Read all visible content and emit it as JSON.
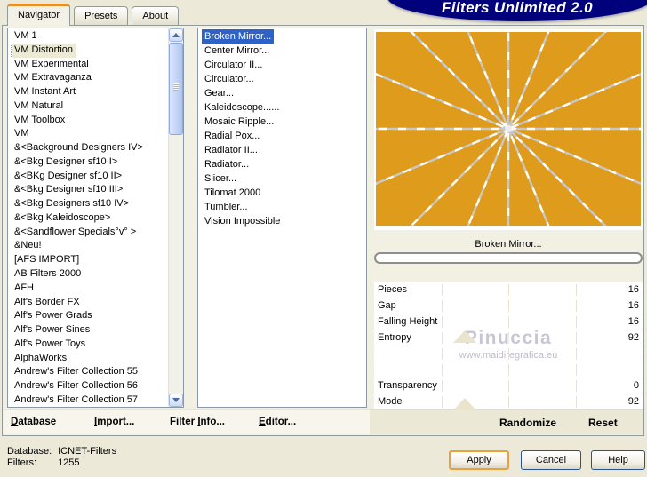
{
  "window": {
    "logo": "Filters Unlimited 2.0"
  },
  "tabs": [
    "Navigator",
    "Presets",
    "About"
  ],
  "colors": {
    "selection": "#2E63C5",
    "logo_bg": "#01017C",
    "preview_bg": "#DF9B1B",
    "accent_tab": "#E5912D"
  },
  "navigator": {
    "selected": "VM Distortion",
    "items": [
      "VM 1",
      "VM Distortion",
      "VM Experimental",
      "VM Extravaganza",
      "VM Instant Art",
      "VM Natural",
      "VM Toolbox",
      "VM",
      "&<Background Designers IV>",
      "&<Bkg Designer sf10 I>",
      "&<BKg Designer sf10 II>",
      "&<Bkg Designer sf10 III>",
      "&<Bkg Designers sf10 IV>",
      "&<Bkg Kaleidoscope>",
      "&<Sandflower Specials°v° >",
      "&Neu!",
      "[AFS IMPORT]",
      "AB Filters 2000",
      "AFH",
      "Alf's Border FX",
      "Alf's Power Grads",
      "Alf's Power Sines",
      "Alf's Power Toys",
      "AlphaWorks",
      "Andrew's Filter Collection 55",
      "Andrew's Filter Collection 56",
      "Andrew's Filter Collection 57"
    ]
  },
  "filters": {
    "selected": "Broken Mirror...",
    "items": [
      "Broken Mirror...",
      "Center Mirror...",
      "Circulator II...",
      "Circulator...",
      "Gear...",
      "Kaleidoscope......",
      "Mosaic Ripple...",
      "Radial Pox...",
      "Radiator II...",
      "Radiator...",
      "Slicer...",
      "Tilomat 2000",
      "Tumbler...",
      "Vision Impossible"
    ]
  },
  "preview": {
    "filter_name": "Broken Mirror...",
    "rays": 16,
    "center_x": 0.5,
    "center_y": 0.5,
    "bg_color": "#DF9B1B",
    "dash_light": "#FFFFFF",
    "dash_dark": "#C8C8C8"
  },
  "progress": {
    "value_percent": 0
  },
  "params": [
    {
      "label": "Pieces",
      "value": 16
    },
    {
      "label": "Gap",
      "value": 16
    },
    {
      "label": "Falling Height",
      "value": 16
    },
    {
      "label": "Entropy",
      "value": 92
    },
    {
      "spacer": true
    },
    {
      "spacer": true
    },
    {
      "label": "Transparency",
      "value": 0
    },
    {
      "label": "Mode",
      "value": 92
    }
  ],
  "watermark": {
    "title": "Pinuccia",
    "url": "www.maidiregrafica.eu"
  },
  "menu": [
    {
      "name": "database-button",
      "pre": "",
      "key": "D",
      "post": "atabase"
    },
    {
      "name": "import-button",
      "pre": "",
      "key": "I",
      "post": "mport..."
    },
    {
      "name": "filter-info-button",
      "pre": "Filter ",
      "key": "I",
      "post": "nfo..."
    },
    {
      "name": "editor-button",
      "pre": "",
      "key": "E",
      "post": "ditor..."
    }
  ],
  "footer": {
    "randomize": "Randomize",
    "reset": "Reset"
  },
  "status": {
    "database_label": "Database:",
    "database_value": "ICNET-Filters",
    "filters_label": "Filters:",
    "filters_value": "1255"
  },
  "actions": {
    "apply": "Apply",
    "cancel": "Cancel",
    "help": "Help"
  }
}
